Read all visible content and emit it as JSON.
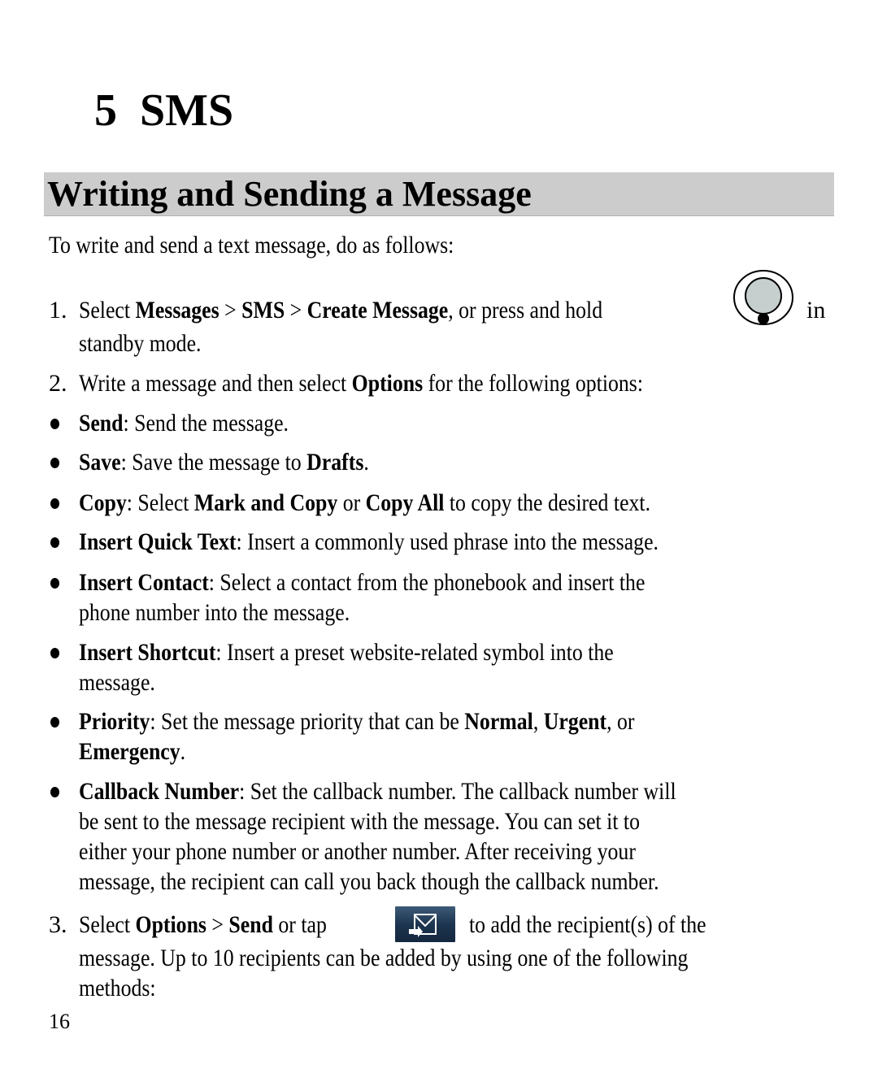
{
  "chapter": {
    "number": "5",
    "title": "SMS"
  },
  "section": {
    "title": "Writing and Sending a Message"
  },
  "intro": "To write and send a text message, do as follows:",
  "steps": [
    {
      "number": "1.",
      "parts": {
        "a": "Select ",
        "b1": "Messages",
        "c": " > ",
        "b2": "SMS",
        "d": " > ",
        "b3": "Create Message",
        "e": ", or press and hold",
        "f": "in",
        "g": "standby mode."
      },
      "icon": "navigation-key-icon"
    },
    {
      "number": "2.",
      "parts": {
        "a": "Write a message and then select ",
        "b1": "Options",
        "c": " for the following options:"
      }
    },
    {
      "number": "3.",
      "parts": {
        "a": "Select ",
        "b1": "Options",
        "c": " > ",
        "b2": "Send",
        "d": " or tap",
        "e": "to add the recipient(s) of the",
        "f": "message. Up to 10 recipients can be added by using one of the following",
        "g": "methods:"
      },
      "icon": "send-message-icon"
    }
  ],
  "options": [
    {
      "term": "Send",
      "lines": [
        ": Send the message."
      ]
    },
    {
      "term": "Save",
      "text_a": ": Save the message to ",
      "bold_b": "Drafts",
      "text_c": "."
    },
    {
      "term": "Copy",
      "text_a": ": Select ",
      "bold_b": "Mark and Copy",
      "text_c": " or ",
      "bold_d": "Copy All",
      "text_e": " to copy the desired text."
    },
    {
      "term": "Insert Quick Text",
      "lines": [
        ": Insert a commonly used phrase into the message."
      ]
    },
    {
      "term": "Insert Contact",
      "lines": [
        ": Select a contact from the phonebook and insert the",
        "phone number into the message."
      ]
    },
    {
      "term": "Insert Shortcut",
      "lines": [
        ": Insert a preset website-related symbol into the",
        "message."
      ]
    },
    {
      "term": "Priority",
      "text_a": ": Set the message priority that can be ",
      "bold_b": "Normal",
      "text_c": ", ",
      "bold_d": "Urgent",
      "text_e": ", or",
      "bold_f": "Emergency",
      "text_g": "."
    },
    {
      "term": "Callback Number",
      "lines": [
        ":  Set the callback number. The callback number will",
        "be sent to the message recipient with the message. You can set it to",
        "either your phone number or another number. After receiving your",
        "message, the recipient can call you back though the callback number."
      ]
    }
  ],
  "page_number": "16"
}
